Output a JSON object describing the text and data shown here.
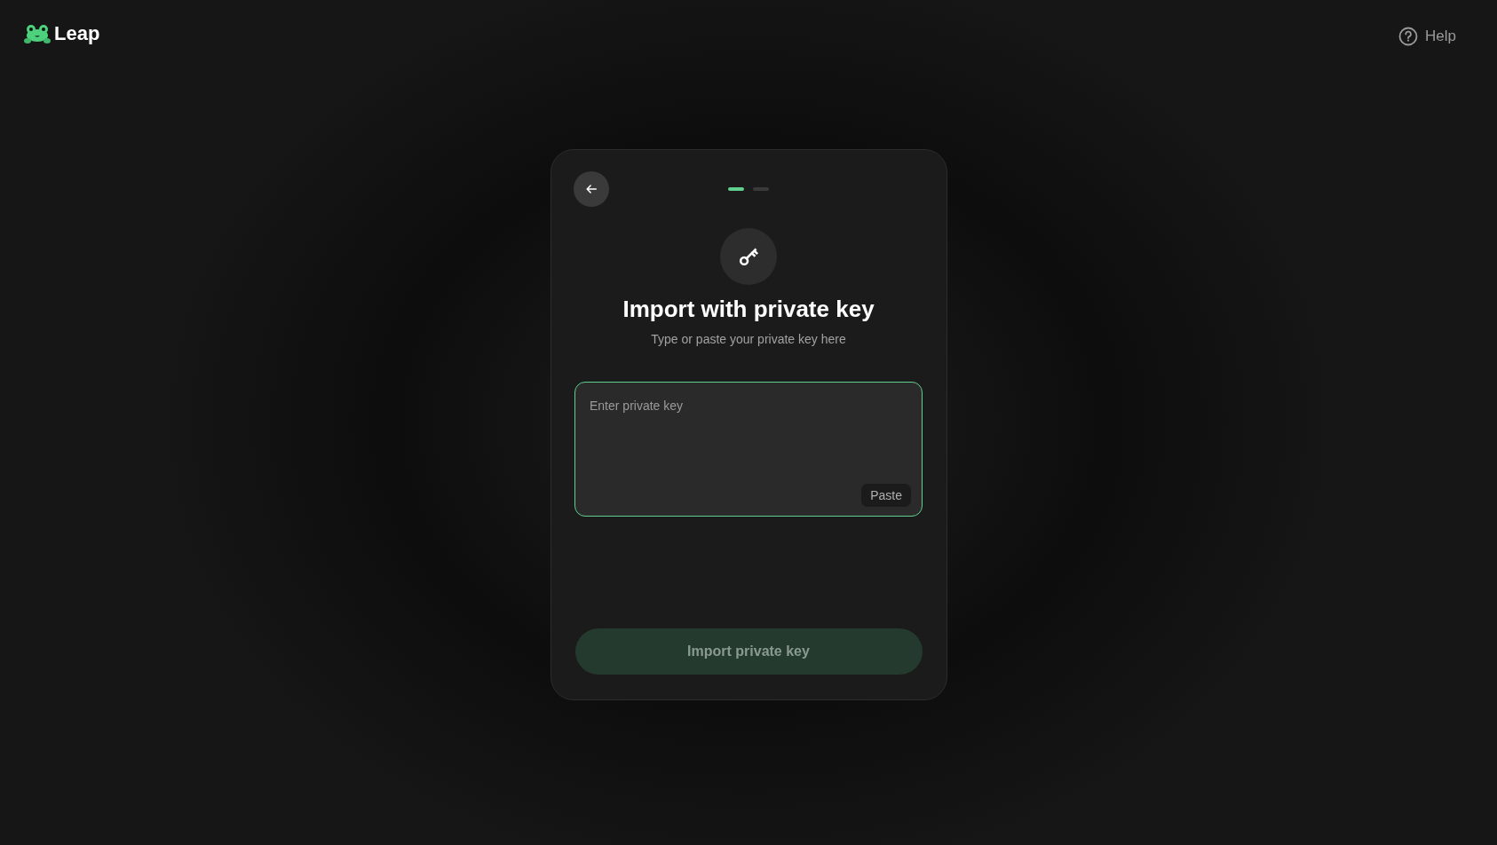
{
  "header": {
    "brand": "Leap",
    "help": "Help"
  },
  "card": {
    "steps": [
      {
        "selected": true
      },
      {
        "selected": false
      }
    ],
    "title": "Import with private key",
    "subtitle": "Type or paste your private key here",
    "key_field": {
      "placeholder": "Enter private key",
      "focused": true,
      "paste": "Paste"
    },
    "submit": {
      "label": "Import private key",
      "disabled": true
    }
  }
}
